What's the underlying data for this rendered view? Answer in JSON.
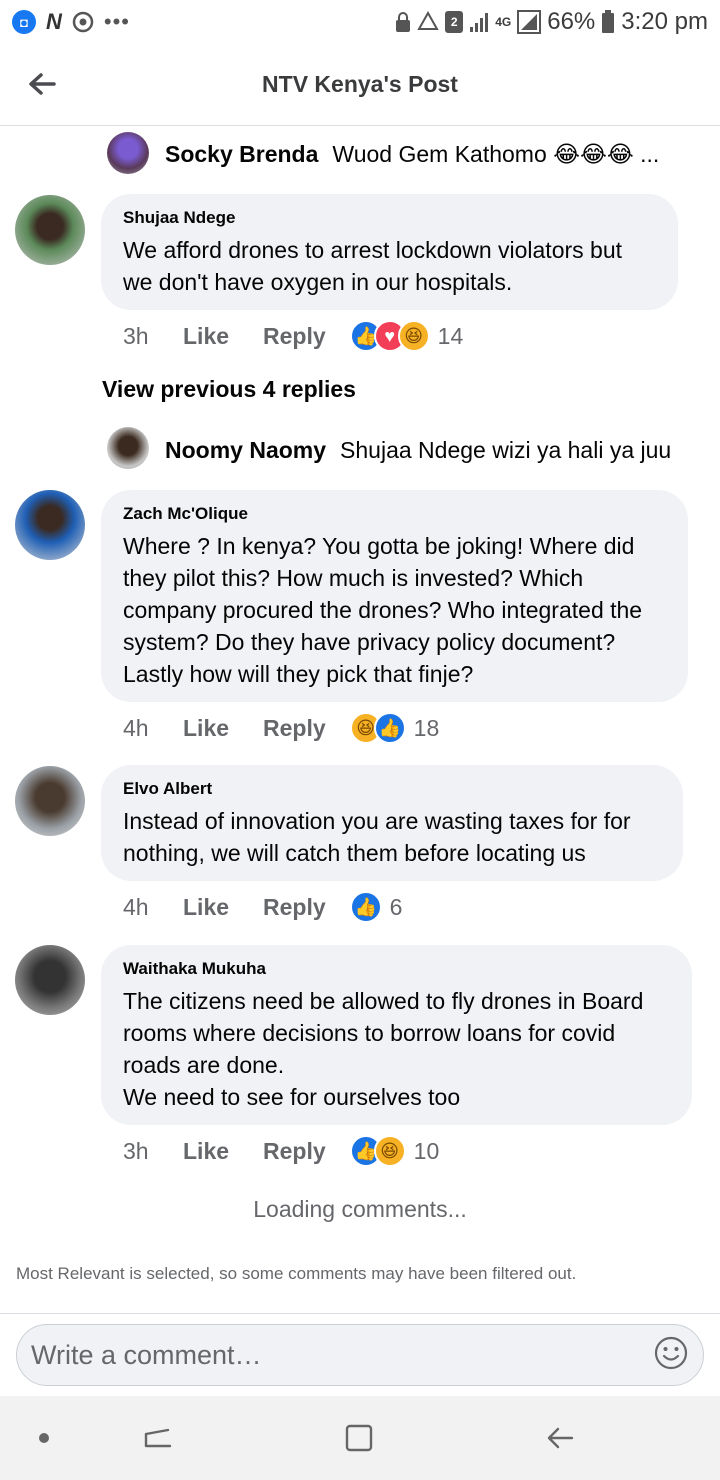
{
  "status_bar": {
    "battery": "66%",
    "time": "3:20 pm",
    "network": "4G",
    "sim": "2",
    "left_icons": [
      "app-icon",
      "n-icon",
      "chrome-icon",
      "more-dots-icon"
    ]
  },
  "header": {
    "title": "NTV Kenya's Post"
  },
  "reply_top": {
    "name": "Socky Brenda",
    "text": "Wuod Gem Kathomo 😂😂😂 ..."
  },
  "comments": [
    {
      "name": "Shujaa Ndege",
      "text": "We afford drones to arrest lockdown violators but we don't have oxygen in our hospitals.",
      "time": "3h",
      "like": "Like",
      "reply": "Reply",
      "reactions": [
        "like",
        "love",
        "haha"
      ],
      "count": "14"
    },
    {
      "name": "Zach Mc'Olique",
      "text": "Where ? In kenya? You gotta be joking! Where did they pilot this? How much is invested? Which company procured the drones? Who integrated the system? Do they have privacy policy document? Lastly how will they pick that finje?",
      "time": "4h",
      "like": "Like",
      "reply": "Reply",
      "reactions": [
        "haha",
        "like"
      ],
      "count": "18"
    },
    {
      "name": "Elvo Albert",
      "text": "Instead of innovation you are wasting taxes for for nothing, we will catch them before locating us",
      "time": "4h",
      "like": "Like",
      "reply": "Reply",
      "reactions": [
        "like"
      ],
      "count": "6"
    },
    {
      "name": "Waithaka Mukuha",
      "text": "The citizens need be allowed to fly drones in Board rooms where   decisions to borrow loans for covid roads are done.\n  We need to see for ourselves too",
      "time": "3h",
      "like": "Like",
      "reply": "Reply",
      "reactions": [
        "like",
        "haha"
      ],
      "count": "10"
    }
  ],
  "view_previous": "View previous 4 replies",
  "reply_mid": {
    "name": "Noomy Naomy",
    "text": "Shujaa Ndege wizi ya hali ya juu"
  },
  "loading_text": "Loading comments...",
  "filter_note": "Most Relevant is selected, so some comments may have been filtered out.",
  "composer": {
    "placeholder": "Write a comment…"
  },
  "colors": {
    "like_blue": "#1b74e4",
    "love_red": "#f33e58",
    "haha_yellow": "#f7b125",
    "bubble_bg": "#f0f2f5",
    "secondary_text": "#65676b"
  }
}
